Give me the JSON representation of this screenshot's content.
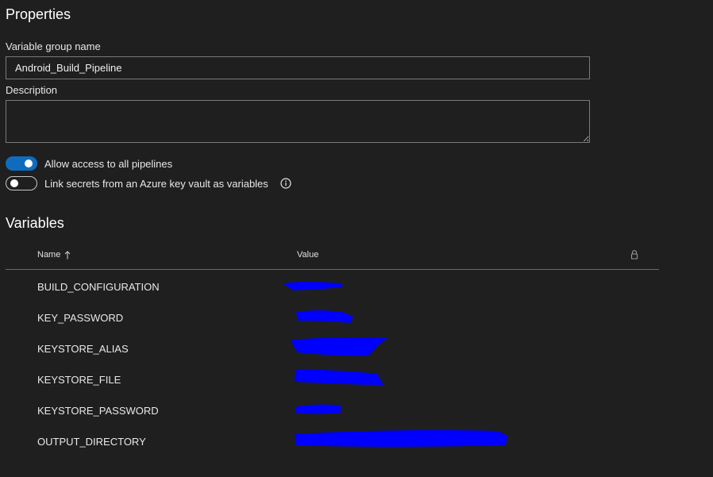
{
  "properties": {
    "title": "Properties",
    "group_name_label": "Variable group name",
    "group_name_value": "Android_Build_Pipeline",
    "description_label": "Description",
    "description_value": ""
  },
  "toggles": {
    "allow_access": {
      "label": "Allow access to all pipelines",
      "on": true
    },
    "link_secrets": {
      "label": "Link secrets from an Azure key vault as variables",
      "on": false
    }
  },
  "variables": {
    "title": "Variables",
    "columns": {
      "name": "Name",
      "value": "Value"
    },
    "rows": [
      {
        "name": "BUILD_CONFIGURATION",
        "value_redacted": true
      },
      {
        "name": "KEY_PASSWORD",
        "value_redacted": true
      },
      {
        "name": "KEYSTORE_ALIAS",
        "value_redacted": true
      },
      {
        "name": "KEYSTORE_FILE",
        "value_redacted": true
      },
      {
        "name": "KEYSTORE_PASSWORD",
        "value_redacted": true
      },
      {
        "name": "OUTPUT_DIRECTORY",
        "value_redacted": true
      }
    ]
  },
  "colors": {
    "background": "#1f1f1f",
    "accent": "#0f6cbd",
    "redaction": "#0000ff"
  },
  "icons": {
    "info": "info-icon",
    "sort": "sort-ascending-icon",
    "lock": "lock-icon"
  }
}
